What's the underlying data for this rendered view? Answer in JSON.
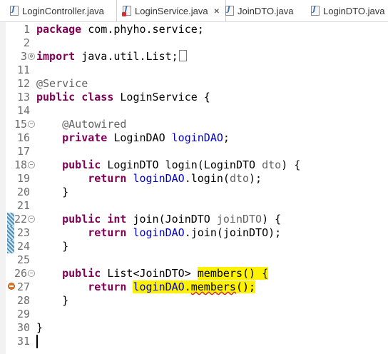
{
  "tabs": [
    {
      "label": "LoginController.java",
      "active": false,
      "error": false
    },
    {
      "label": "LoginService.java",
      "active": true,
      "error": true,
      "close": "×"
    },
    {
      "label": "JoinDTO.java",
      "active": false,
      "error": false
    },
    {
      "label": "LoginDTO.java",
      "active": false,
      "error": false
    }
  ],
  "lines": {
    "n1": "1",
    "n2": "2",
    "n3": "3",
    "n11": "11",
    "n12": "12",
    "n13": "13",
    "n14": "14",
    "n15": "15",
    "n16": "16",
    "n17": "17",
    "n18": "18",
    "n19": "19",
    "n20": "20",
    "n21": "21",
    "n22": "22",
    "n23": "23",
    "n24": "24",
    "n25": "25",
    "n26": "26",
    "n27": "27",
    "n28": "28",
    "n29": "29",
    "n30": "30",
    "n31": "31"
  },
  "code": {
    "package_kw": "package",
    "package_name": " com.phyho.service;",
    "import_kw": "import",
    "import_name": " java.util.List;",
    "service_ann": "@Service",
    "public": "public",
    "class": "class",
    "class_name": " LoginService {",
    "autowired_ann": "@Autowired",
    "private": "private",
    "dao_type": " LoginDAO ",
    "dao_field": "loginDAO",
    "semicolon": ";",
    "login_sig_a": " LoginDTO login(LoginDTO ",
    "login_param": "dto",
    "login_sig_b": ") {",
    "return": "return",
    "login_call": ".login(",
    "login_arg": "dto",
    "close_call": ");",
    "close_brace": "}",
    "int": "int",
    "join_sig_a": " join(JoinDTO ",
    "join_param": "joinDTO",
    "join_sig_b": ") {",
    "join_call": ".join(",
    "join_arg": "joinDTO",
    "list_type": " List<JoinDTO> ",
    "members_sig": "members() {",
    "members_call_a": ".",
    "members_name": "members",
    "members_call_b": "();"
  },
  "colors": {
    "keyword": "#7f0055",
    "annotation": "#646464",
    "field": "#0000c0",
    "highlight": "#fff200",
    "error": "#d32f2f"
  },
  "icons": [
    "java-file-icon",
    "error-overlay-icon",
    "fold-toggle-icon",
    "error-marker-icon",
    "close-icon"
  ]
}
